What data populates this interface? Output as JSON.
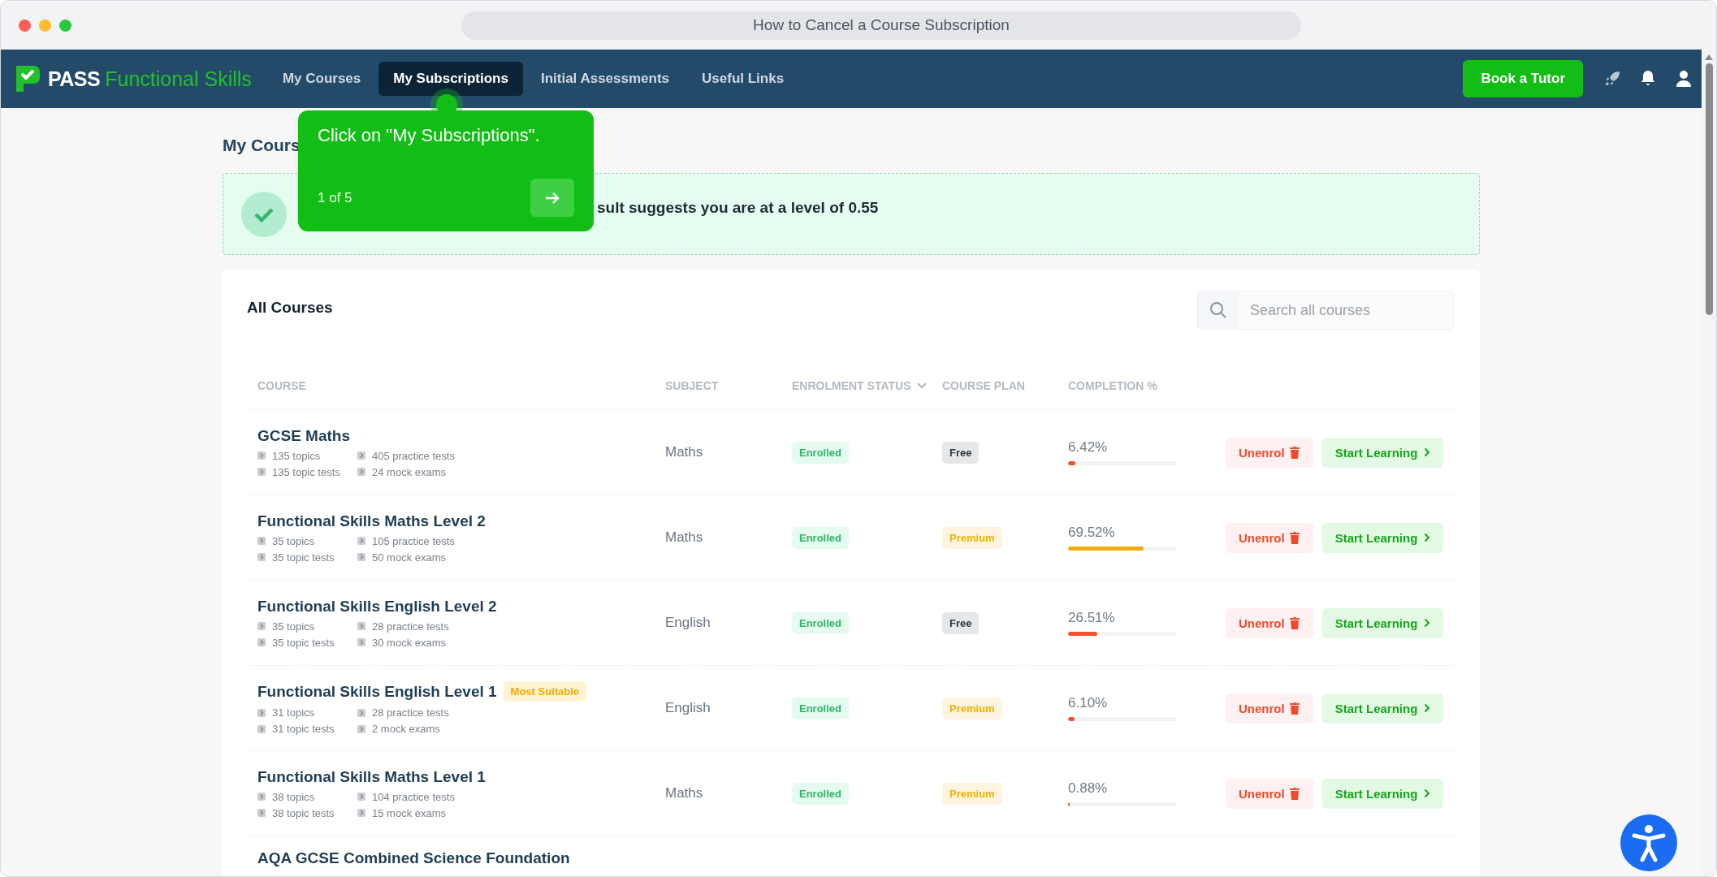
{
  "window": {
    "title": "How to Cancel a Course Subscription"
  },
  "nav": {
    "brand_bold": "PASS",
    "brand_light": "Functional Skills",
    "tabs": [
      {
        "label": "My Courses",
        "selected": false
      },
      {
        "label": "My Subscriptions",
        "selected": true
      },
      {
        "label": "Initial Assessments",
        "selected": false
      },
      {
        "label": "Useful Links",
        "selected": false
      }
    ],
    "cta": "Book a Tutor"
  },
  "tooltip": {
    "text": "Click on \"My Subscriptions\".",
    "step": "1 of 5"
  },
  "heading": "My Cours",
  "banner": {
    "text": "sult suggests you are at a level of 0.55"
  },
  "card": {
    "title": "All Courses",
    "search": {
      "placeholder": "Search all courses"
    },
    "columns": [
      "COURSE",
      "SUBJECT",
      "ENROLMENT STATUS",
      "COURSE PLAN",
      "COMPLETION %"
    ],
    "rows": [
      {
        "kind": "full",
        "title": "GCSE Maths",
        "stats": [
          "135 topics",
          "405 practice tests",
          "135 topic tests",
          "24 mock exams"
        ],
        "subject": "Maths",
        "status": "Enrolled",
        "plan": "Free",
        "color": "#2a3742",
        "completion": "6.42%",
        "level": 0.0642,
        "unenrol": "Unenrol",
        "start": "Start Learning"
      },
      {
        "kind": "full",
        "title": "Functional Skills Maths Level 2",
        "stats": [
          "35 topics",
          "105 practice tests",
          "35 topic tests",
          "50 mock exams"
        ],
        "subject": "Maths",
        "status": "Enrolled",
        "plan": "Premium",
        "color": "#f0b000",
        "completion": "69.52%",
        "level": 0.6952,
        "unenrol": "Unenrol",
        "start": "Start Learning"
      },
      {
        "kind": "full",
        "title": "Functional Skills English Level 2",
        "stats": [
          "35 topics",
          "28 practice tests",
          "35 topic tests",
          "30 mock exams"
        ],
        "subject": "English",
        "status": "Enrolled",
        "plan": "Free",
        "color": "#2a3742",
        "completion": "26.51%",
        "level": 0.2651,
        "unenrol": "Unenrol",
        "start": "Start Learning"
      },
      {
        "kind": "full",
        "title": "Functional Skills English Level 1",
        "badge": "Most Suitable",
        "stats": [
          "31 topics",
          "28 practice tests",
          "31 topic tests",
          "2 mock exams"
        ],
        "subject": "English",
        "status": "Enrolled",
        "plan": "Premium",
        "color": "#f0b000",
        "completion": "6.10%",
        "level": 0.061,
        "unenrol": "Unenrol",
        "start": "Start Learning"
      },
      {
        "kind": "full",
        "title": "Functional Skills Maths Level 1",
        "stats": [
          "38 topics",
          "104 practice tests",
          "38 topic tests",
          "15 mock exams"
        ],
        "subject": "Maths",
        "status": "Enrolled",
        "plan": "Premium",
        "color": "#f0b000",
        "completion": "0.88%",
        "level": 0.0088,
        "unenrol": "Unenrol",
        "start": "Start Learning"
      },
      {
        "kind": "partial",
        "title": "AQA GCSE Combined Science Foundation"
      }
    ]
  }
}
